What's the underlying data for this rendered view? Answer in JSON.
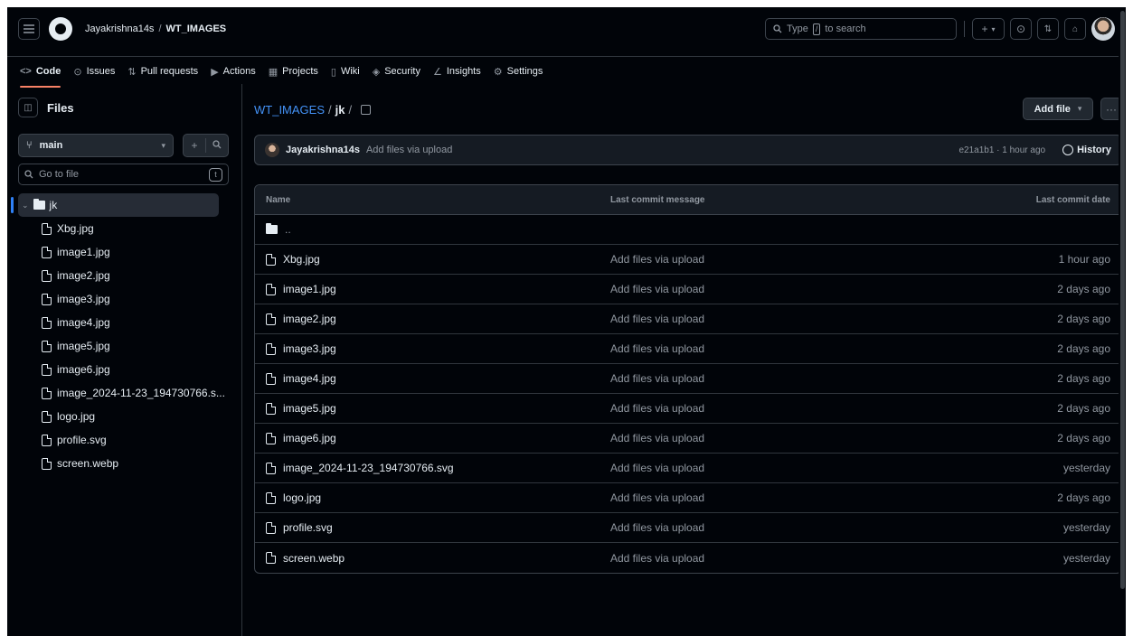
{
  "header": {
    "owner": "Jayakrishna14s",
    "separator": "/",
    "repo": "WT_IMAGES",
    "search_prefix": "Type",
    "search_key": "/",
    "search_suffix": "to search"
  },
  "tabs": [
    {
      "icon": "<>",
      "label": "Code"
    },
    {
      "icon": "⊙",
      "label": "Issues"
    },
    {
      "icon": "⇅",
      "label": "Pull requests"
    },
    {
      "icon": "▶",
      "label": "Actions"
    },
    {
      "icon": "▦",
      "label": "Projects"
    },
    {
      "icon": "▯",
      "label": "Wiki"
    },
    {
      "icon": "◈",
      "label": "Security"
    },
    {
      "icon": "∠",
      "label": "Insights"
    },
    {
      "icon": "⚙",
      "label": "Settings"
    }
  ],
  "sidebar": {
    "title": "Files",
    "branch": "main",
    "goto_placeholder": "Go to file",
    "goto_key": "t",
    "folder": "jk",
    "files": [
      "Xbg.jpg",
      "image1.jpg",
      "image2.jpg",
      "image3.jpg",
      "image4.jpg",
      "image5.jpg",
      "image6.jpg",
      "image_2024-11-23_194730766.s...",
      "logo.jpg",
      "profile.svg",
      "screen.webp"
    ]
  },
  "main": {
    "path_repo": "WT_IMAGES",
    "path_sep": "/",
    "path_folder": "jk",
    "path_trail": "/",
    "add_file": "Add file",
    "more": "···",
    "commit": {
      "author": "Jayakrishna14s",
      "message": "Add files via upload",
      "sha_time": "e21a1b1 · 1 hour ago",
      "history": "History"
    },
    "table": {
      "col_name": "Name",
      "col_message": "Last commit message",
      "col_date": "Last commit date",
      "parent": "..",
      "rows": [
        {
          "name": "Xbg.jpg",
          "message": "Add files via upload",
          "date": "1 hour ago"
        },
        {
          "name": "image1.jpg",
          "message": "Add files via upload",
          "date": "2 days ago"
        },
        {
          "name": "image2.jpg",
          "message": "Add files via upload",
          "date": "2 days ago"
        },
        {
          "name": "image3.jpg",
          "message": "Add files via upload",
          "date": "2 days ago"
        },
        {
          "name": "image4.jpg",
          "message": "Add files via upload",
          "date": "2 days ago"
        },
        {
          "name": "image5.jpg",
          "message": "Add files via upload",
          "date": "2 days ago"
        },
        {
          "name": "image6.jpg",
          "message": "Add files via upload",
          "date": "2 days ago"
        },
        {
          "name": "image_2024-11-23_194730766.svg",
          "message": "Add files via upload",
          "date": "yesterday"
        },
        {
          "name": "logo.jpg",
          "message": "Add files via upload",
          "date": "2 days ago"
        },
        {
          "name": "profile.svg",
          "message": "Add files via upload",
          "date": "yesterday"
        },
        {
          "name": "screen.webp",
          "message": "Add files via upload",
          "date": "yesterday"
        }
      ]
    }
  },
  "colors": {
    "background": "#010409",
    "accent": "#f78166",
    "link": "#4493f8"
  }
}
